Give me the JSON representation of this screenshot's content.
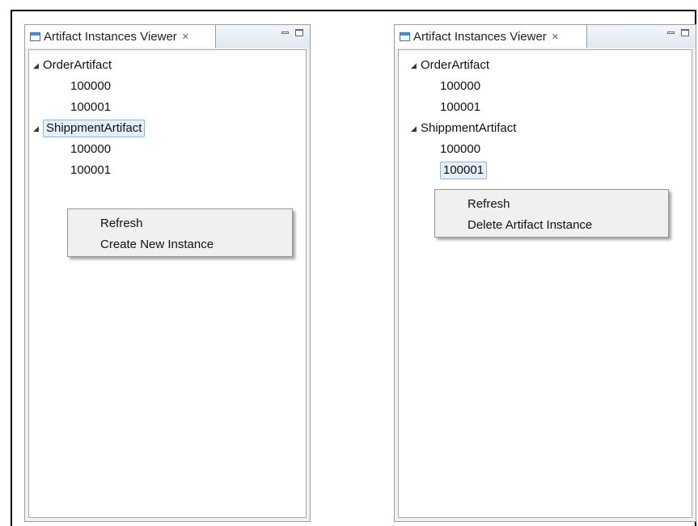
{
  "left_panel": {
    "tab_title": "Artifact Instances Viewer",
    "tree": [
      {
        "label": "OrderArtifact",
        "children": [
          "100000",
          "100001"
        ]
      },
      {
        "label": "ShippmentArtifact",
        "children": [
          "100000",
          "100001"
        ]
      }
    ],
    "context_menu": [
      "Refresh",
      "Create New Instance"
    ]
  },
  "right_panel": {
    "tab_title": "Artifact Instances Viewer",
    "tree": [
      {
        "label": "OrderArtifact",
        "children": [
          "100000",
          "100001"
        ]
      },
      {
        "label": "ShippmentArtifact",
        "children": [
          "100000",
          "100001"
        ]
      }
    ],
    "context_menu": [
      "Refresh",
      "Delete Artifact Instance"
    ]
  },
  "icons": {
    "view": "view-icon",
    "close": "close-icon",
    "minimize": "minimize-icon",
    "maximize": "maximize-icon",
    "expander": "triangle-expanded-icon"
  },
  "colors": {
    "selection_fill": "#e4effa",
    "selection_border": "#8fb6e0",
    "tab_icon": "#3c71b0"
  }
}
